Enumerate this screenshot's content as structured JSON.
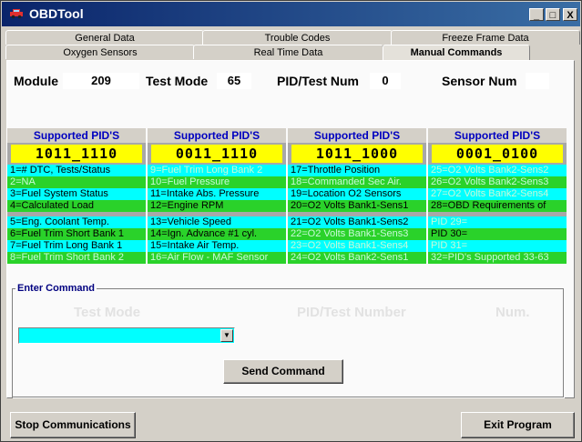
{
  "window": {
    "title": "OBDTool",
    "minimize": "_",
    "maximize": "□",
    "close": "X"
  },
  "tabs": {
    "row1": [
      "General Data",
      "Trouble Codes",
      "Freeze Frame Data"
    ],
    "row2": [
      "Oxygen Sensors",
      "Real Time Data",
      "Manual Commands"
    ],
    "active": "Manual Commands"
  },
  "fields": {
    "module_label": "Module",
    "module_value": "209",
    "test_mode_label": "Test Mode",
    "test_mode_value": "65",
    "pid_label": "PID/Test Num",
    "pid_value": "0",
    "sensor_label": "Sensor Num",
    "sensor_value": ""
  },
  "pid_columns": [
    {
      "header": "Supported PID'S",
      "bits": "1011_1110",
      "rows": [
        {
          "text": "1=# DTC, Tests/Status",
          "color": "cyan",
          "supported": true
        },
        {
          "text": "2=NA",
          "color": "green",
          "supported": false
        },
        {
          "text": "3=Fuel System Status",
          "color": "cyan",
          "supported": true
        },
        {
          "text": "4=Calculated Load",
          "color": "green",
          "supported": true
        },
        {
          "text": "5=Eng. Coolant Temp.",
          "color": "cyan",
          "supported": true
        },
        {
          "text": "6=Fuel Trim Short Bank 1",
          "color": "green",
          "supported": true
        },
        {
          "text": "7=Fuel Trim Long Bank 1",
          "color": "cyan",
          "supported": true
        },
        {
          "text": "8=Fuel Trim Short Bank 2",
          "color": "green",
          "supported": false
        }
      ]
    },
    {
      "header": "Supported PID'S",
      "bits": "0011_1110",
      "rows": [
        {
          "text": "9=Fuel Trim Long Bank 2",
          "color": "cyan",
          "supported": false
        },
        {
          "text": "10=Fuel Pressure",
          "color": "green",
          "supported": false
        },
        {
          "text": "11=Intake Abs. Pressure",
          "color": "cyan",
          "supported": true
        },
        {
          "text": "12=Engine RPM",
          "color": "green",
          "supported": true
        },
        {
          "text": "13=Vehicle Speed",
          "color": "cyan",
          "supported": true
        },
        {
          "text": "14=Ign. Advance #1 cyl.",
          "color": "green",
          "supported": true
        },
        {
          "text": "15=Intake Air Temp.",
          "color": "cyan",
          "supported": true
        },
        {
          "text": "16=Air Flow - MAF Sensor",
          "color": "green",
          "supported": false
        }
      ]
    },
    {
      "header": "Supported PID'S",
      "bits": "1011_1000",
      "rows": [
        {
          "text": "17=Throttle Position",
          "color": "cyan",
          "supported": true
        },
        {
          "text": "18=Commanded Sec Air.",
          "color": "green",
          "supported": false
        },
        {
          "text": "19=Location O2 Sensors",
          "color": "cyan",
          "supported": true
        },
        {
          "text": "20=O2 Volts Bank1-Sens1",
          "color": "green",
          "supported": true
        },
        {
          "text": "21=O2 Volts Bank1-Sens2",
          "color": "cyan",
          "supported": true
        },
        {
          "text": "22=O2 Volts Bank1-Sens3",
          "color": "green",
          "supported": false
        },
        {
          "text": "23=O2 Volts Bank1-Sens4",
          "color": "cyan",
          "supported": false
        },
        {
          "text": "24=O2 Volts Bank2-Sens1",
          "color": "green",
          "supported": false
        }
      ]
    },
    {
      "header": "Supported PID'S",
      "bits": "0001_0100",
      "rows": [
        {
          "text": "25=O2 Volts Bank2-Sens2",
          "color": "cyan",
          "supported": false
        },
        {
          "text": "26=O2 Volts Bank2-Sens3",
          "color": "green",
          "supported": false
        },
        {
          "text": "27=O2 Volts Bank2-Sens4",
          "color": "cyan",
          "supported": false
        },
        {
          "text": "28=OBD Requirements of",
          "color": "green",
          "supported": true
        },
        {
          "text": "PID 29=",
          "color": "cyan",
          "supported": false
        },
        {
          "text": "PID 30=",
          "color": "green",
          "supported": true
        },
        {
          "text": "PID 31=",
          "color": "cyan",
          "supported": false
        },
        {
          "text": "32=PID's Supported 33-63",
          "color": "green",
          "supported": false
        }
      ]
    }
  ],
  "enter_command": {
    "label": "Enter Command",
    "col_test_mode": "Test Mode",
    "col_pid": "PID/Test Number",
    "col_num": "Num.",
    "combo_value": "",
    "send_button": "Send Command"
  },
  "footer": {
    "stop_button": "Stop Communications",
    "exit_button": "Exit Program"
  },
  "colors": {
    "cyan": "#00ffff",
    "green": "#2ad22a",
    "yellow": "#ffff00",
    "header_text": "#0000c0",
    "title_bar": "#0a246a"
  }
}
